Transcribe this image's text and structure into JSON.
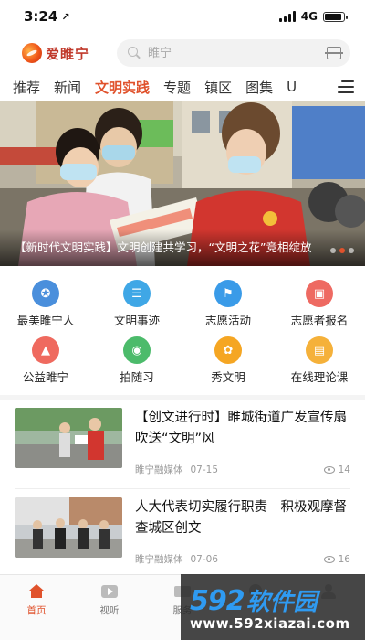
{
  "status_bar": {
    "time": "3:24",
    "location_arrow": "↗",
    "network": "4G",
    "battery_level": 0.9
  },
  "header": {
    "app_name": "爱睢宁",
    "search_placeholder": "睢宁"
  },
  "tabs": [
    {
      "label": "推荐",
      "active": false
    },
    {
      "label": "新闻",
      "active": false
    },
    {
      "label": "文明实践",
      "active": true
    },
    {
      "label": "专题",
      "active": false
    },
    {
      "label": "镇区",
      "active": false
    },
    {
      "label": "图集",
      "active": false
    },
    {
      "label": "U",
      "active": false
    }
  ],
  "banner": {
    "caption": "【新时代文明实践】文明创建共学习，“文明之花”竞相绽放",
    "dots": 3,
    "active_dot": 1
  },
  "quick_links": [
    {
      "label": "最美睢宁人",
      "icon": "person-award-icon",
      "color": "#4a8fdc",
      "glyph": "✪"
    },
    {
      "label": "文明事迹",
      "icon": "document-list-icon",
      "color": "#3fa7e6",
      "glyph": "☰"
    },
    {
      "label": "志愿活动",
      "icon": "flag-icon",
      "color": "#3a9be8",
      "glyph": "⚑"
    },
    {
      "label": "志愿者报名",
      "icon": "signup-form-icon",
      "color": "#ee6a62",
      "glyph": "▣"
    },
    {
      "label": "公益睢宁",
      "icon": "graduation-cap-icon",
      "color": "#ef6a5f",
      "glyph": "▲"
    },
    {
      "label": "拍随习",
      "icon": "camera-icon",
      "color": "#4cbb6b",
      "glyph": "◉"
    },
    {
      "label": "秀文明",
      "icon": "flower-icon",
      "color": "#f5a623",
      "glyph": "✿"
    },
    {
      "label": "在线理论课",
      "icon": "book-icon",
      "color": "#f5b13a",
      "glyph": "▤"
    }
  ],
  "news": [
    {
      "title": "【创文进行时】睢城街道广发宣传扇 吹送“文明”风",
      "source": "睢宁融媒体",
      "date": "07-15",
      "views": "14"
    },
    {
      "title": "人大代表切实履行职责　积极观摩督查城区创文",
      "source": "睢宁融媒体",
      "date": "07-06",
      "views": "16"
    }
  ],
  "bottom_nav": [
    {
      "label": "首页",
      "icon": "home-icon",
      "active": true
    },
    {
      "label": "视听",
      "icon": "video-icon",
      "active": false
    },
    {
      "label": "服务",
      "icon": "service-icon",
      "active": false
    },
    {
      "label": "",
      "icon": "generic-icon",
      "active": false
    },
    {
      "label": "",
      "icon": "user-icon",
      "active": false
    }
  ],
  "watermark": {
    "number": "592",
    "brand": "软件园",
    "url": "www.592xiazai.com"
  },
  "colors": {
    "accent": "#e0522c",
    "watermark_blue": "#2f9bf2"
  }
}
